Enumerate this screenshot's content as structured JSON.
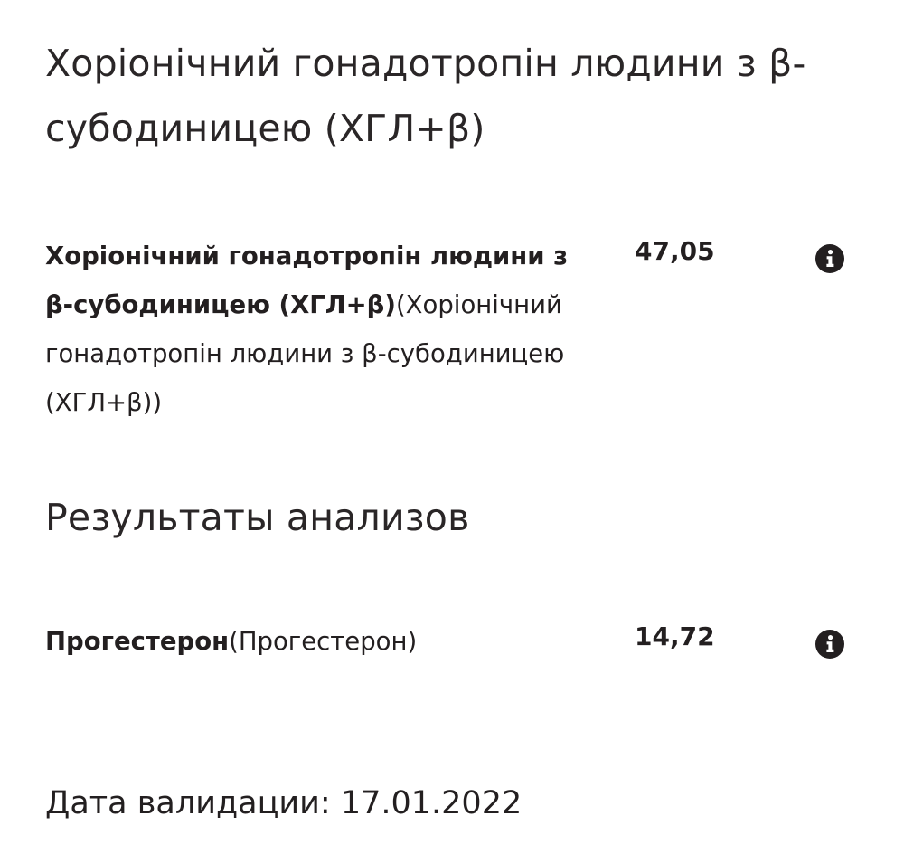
{
  "sections": [
    {
      "title": "Хоріонічний гонадотропін людини з β-субодиницею (ХГЛ+β)",
      "results": [
        {
          "name_bold": "Хоріонічний гонадотропін людини з β-субодиницею (ХГЛ+β)",
          "name_plain": "(Хоріонічний гонадотропін людини з β-субодиницею (ХГЛ+β))",
          "value": "47,05",
          "icon": "info-icon"
        }
      ]
    },
    {
      "title": "Результаты анализов",
      "results": [
        {
          "name_bold": "Прогестерон",
          "name_plain": "(Прогестерон)",
          "value": "14,72",
          "icon": "info-icon"
        }
      ]
    }
  ],
  "validation": {
    "label": "Дата валидации:",
    "date": "17.01.2022"
  },
  "colors": {
    "text": "#231f20",
    "icon": "#231f20",
    "background": "#ffffff"
  }
}
